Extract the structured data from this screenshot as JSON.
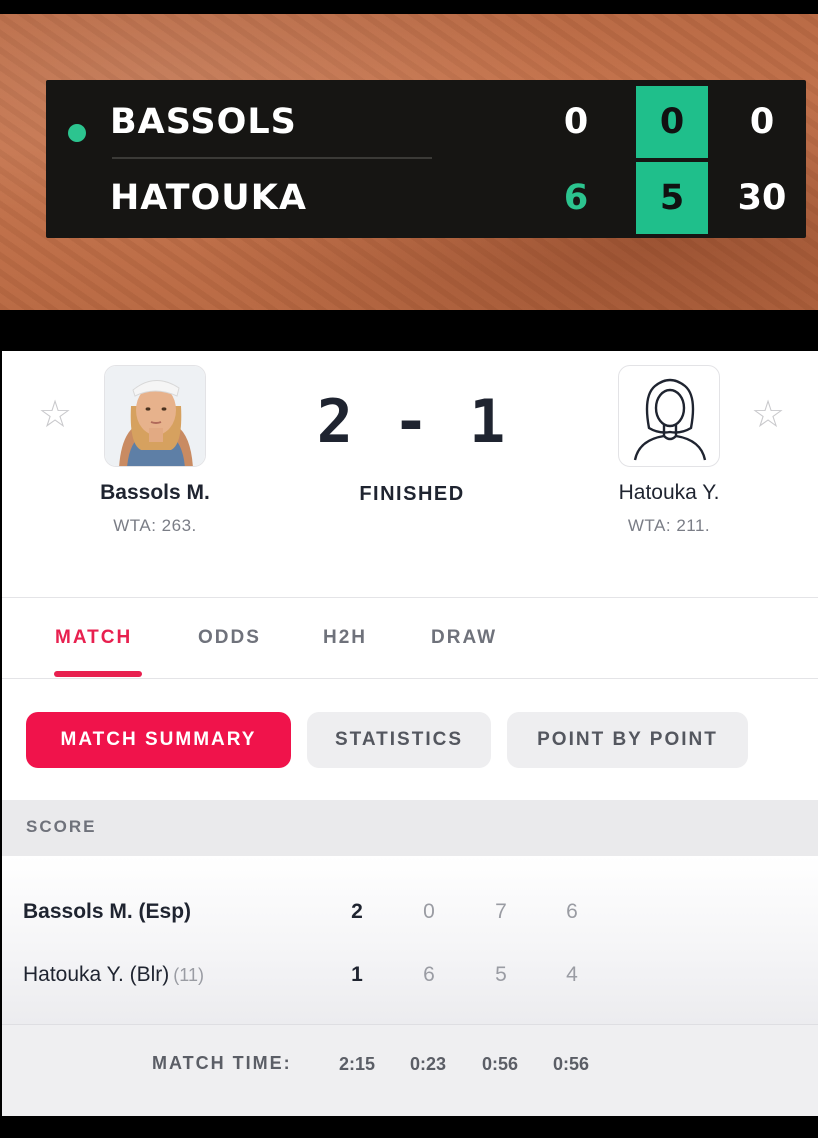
{
  "scorebug": {
    "players": [
      {
        "name": "BASSOLS",
        "serving": true,
        "set1": "0",
        "set2": "0",
        "game": "0"
      },
      {
        "name": "HATOUKA",
        "serving": false,
        "set1": "6",
        "set2": "5",
        "game": "30"
      }
    ],
    "colors": {
      "accent": "#1fbf8b",
      "background": "#161513"
    }
  },
  "match": {
    "home": {
      "name": "Bassols M.",
      "rank": "WTA: 263."
    },
    "away": {
      "name": "Hatouka Y.",
      "rank": "WTA: 211."
    },
    "score": "2-1",
    "status": "FINISHED"
  },
  "tabs": [
    {
      "label": "MATCH",
      "active": true
    },
    {
      "label": "ODDS",
      "active": false
    },
    {
      "label": "H2H",
      "active": false
    },
    {
      "label": "DRAW",
      "active": false
    }
  ],
  "subtabs": [
    {
      "label": "MATCH SUMMARY",
      "active": true
    },
    {
      "label": "STATISTICS",
      "active": false
    },
    {
      "label": "POINT BY POINT",
      "active": false
    }
  ],
  "score_table": {
    "header": "SCORE",
    "rows": [
      {
        "name": "Bassols M. (Esp)",
        "seed": "",
        "total": "2",
        "sets": [
          "0",
          "7",
          "6"
        ]
      },
      {
        "name": "Hatouka Y. (Blr)",
        "seed": "(11)",
        "total": "1",
        "sets": [
          "6",
          "5",
          "4"
        ]
      }
    ],
    "match_time_label": "MATCH TIME:",
    "times": [
      "2:15",
      "0:23",
      "0:56",
      "0:56"
    ]
  },
  "colors": {
    "brand": "#e8204f",
    "active_pill": "#f0134b"
  }
}
